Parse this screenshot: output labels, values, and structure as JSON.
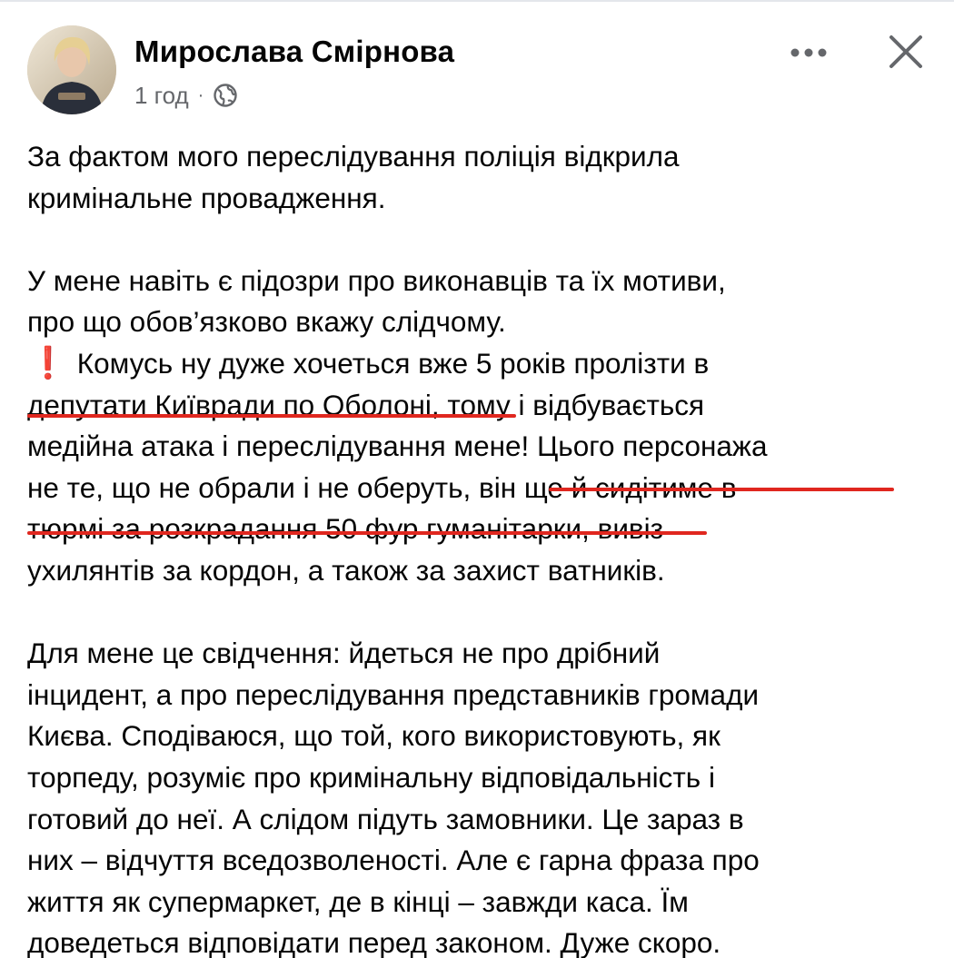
{
  "post": {
    "author": "Мирослава Смірнова",
    "time": "1 год",
    "separator": "·",
    "privacy_icon": "globe-icon",
    "more_icon": "more-options-icon",
    "close_icon": "close-icon",
    "accent_color": "#e0271f"
  },
  "content": {
    "p1": [
      "За фактом мого переслідування поліція відкрила",
      "кримінальне провадження."
    ],
    "p2": [
      "У мене навіть є підозри про виконавців та їх мотиви,",
      "про що обов’язково вкажу слідчому."
    ],
    "p2_exclaim": "❗",
    "p2_after_exclaim": "Комусь ну дуже хочеться вже 5 років пролізти в",
    "p2_rest": [
      "депутати Київради по Оболоні, тому і відбувається",
      "медійна атака і переслідування мене! Цього персонажа",
      "не те, що не обрали і не оберуть, він ще й сидітиме в",
      "тюрмі за розкрадання 50 фур гуманітарки, вивіз",
      "ухилянтів за кордон, а також за захист ватників."
    ],
    "p3": [
      "Для мене це свідчення: йдеться не про дрібний",
      "інцидент, а про переслідування представників громади",
      "Києва. Сподіваюся, що той, кого використовують, як",
      "торпеду, розуміє про кримінальну відповідальність і",
      "готовий до неї. А слідом підуть замовники. Це зараз в",
      "них – відчуття вседозволеності. Але є гарна фраза про",
      "життя як супермаркет, де в кінці – завжди каса. Їм",
      "доведеться відповідати перед законом. Дуже скоро."
    ]
  }
}
